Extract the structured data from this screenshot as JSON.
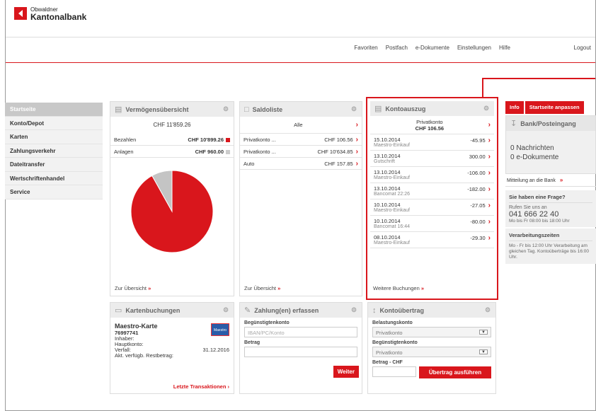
{
  "brand": {
    "line1": "Obwaldner",
    "line2": "Kantonalbank"
  },
  "topnav": [
    "Favoriten",
    "Postfach",
    "e-Dokumente",
    "Einstellungen",
    "Hilfe"
  ],
  "logout": "Logout",
  "sidebar": [
    "Startseite",
    "Konto/Depot",
    "Karten",
    "Zahlungsverkehr",
    "Dateitransfer",
    "Wertschriftenhandel",
    "Service"
  ],
  "vermoegen": {
    "title": "Vermögensübersicht",
    "total": "CHF 11'859.26",
    "rows": [
      {
        "label": "Bezahlen",
        "value": "CHF 10'899.26",
        "color": "#d9161c"
      },
      {
        "label": "Anlagen",
        "value": "CHF 960.00",
        "color": "#bbbbbb"
      }
    ],
    "footer": "Zur Übersicht",
    "chart_data": {
      "type": "pie",
      "categories": [
        "Bezahlen",
        "Anlagen"
      ],
      "values": [
        10899.26,
        960.0
      ],
      "colors": [
        "#d9161c",
        "#c4c4c4"
      ]
    }
  },
  "saldo": {
    "title": "Saldoliste",
    "filter": "Alle",
    "rows": [
      {
        "label": "Privatkonto ...",
        "value": "CHF 106.56"
      },
      {
        "label": "Privatkonto ...",
        "value": "CHF 10'634.85"
      },
      {
        "label": "Auto",
        "value": "CHF 157.85"
      }
    ],
    "footer": "Zur Übersicht"
  },
  "konto": {
    "title": "Kontoauszug",
    "account": "Privatkonto",
    "balance": "CHF 106.56",
    "rows": [
      {
        "date": "15.10.2014",
        "desc": "Maestro-Einkauf",
        "amount": "-45.95"
      },
      {
        "date": "13.10.2014",
        "desc": "Gutschrift",
        "amount": "300.00"
      },
      {
        "date": "13.10.2014",
        "desc": "Maestro-Einkauf",
        "amount": "-106.00"
      },
      {
        "date": "13.10.2014",
        "desc": "Bancomat 22:26",
        "amount": "-182.00"
      },
      {
        "date": "10.10.2014",
        "desc": "Maestro-Einkauf",
        "amount": "-27.05"
      },
      {
        "date": "10.10.2014",
        "desc": "Bancomat 16:44",
        "amount": "-80.00"
      },
      {
        "date": "08.10.2014",
        "desc": "Maestro-Einkauf",
        "amount": "-29.30"
      }
    ],
    "footer": "Weitere Buchungen"
  },
  "karten": {
    "title": "Kartenbuchungen",
    "name": "Maestro-Karte",
    "number": "76997741",
    "inhaber": "Inhaber:",
    "hauptkonto": "Hauptkonto:",
    "verfall": "Verfall:",
    "verfall_date": "31.12.2016",
    "restbetrag": "Akt. verfügb. Restbetrag:",
    "logo": "Maestro",
    "button": "Letzte Transaktionen"
  },
  "zahlung": {
    "title": "Zahlung(en) erfassen",
    "label1": "Begünstigtenkonto",
    "placeholder1": "IBAN/PC/Konto",
    "label2": "Betrag",
    "button": "Weiter"
  },
  "uebertrag": {
    "title": "Kontoübertrag",
    "label1": "Belastungskonto",
    "select1": "Privatkonto",
    "label2": "Begünstigtenkonto",
    "select2": "Privatkonto",
    "label3": "Betrag - CHF",
    "button": "Übertrag ausführen"
  },
  "right": {
    "tab_info": "Info",
    "tab_anpassen": "Startseite anpassen",
    "box_title": "Bank/Posteingang",
    "nachrichten": "0 Nachrichten",
    "dokumente": "0 e-Dokumente",
    "mitteilung": "Mitteilung an die Bank",
    "frage_title": "Sie haben eine Frage?",
    "frage_line1": "Rufen Sie uns an",
    "phone": "041 666 22 40",
    "hours": "Mo bis Fr 08:00 bis 18:00 Uhr",
    "verarb_title": "Verarbeitungszeiten",
    "verarb_text": "Mo - Fr bis 12:00 Uhr Verarbeitung am gleichen Tag. Kontoüberträge bis 16:00 Uhr."
  }
}
